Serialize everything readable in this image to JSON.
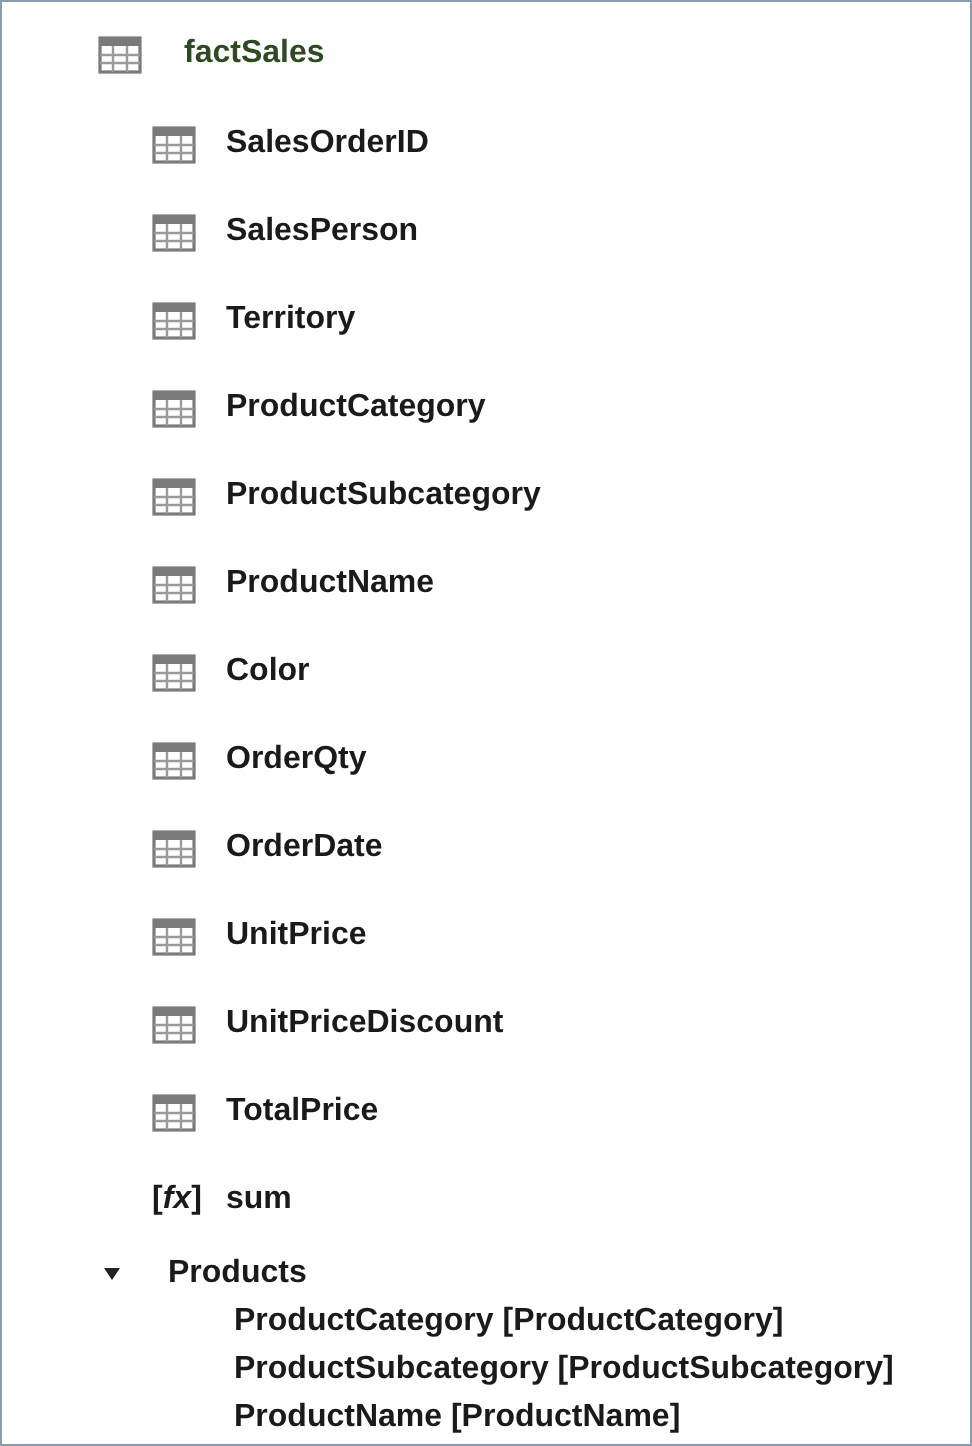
{
  "table": {
    "name": "factSales"
  },
  "fields": [
    {
      "kind": "column",
      "name": "SalesOrderID"
    },
    {
      "kind": "column",
      "name": "SalesPerson"
    },
    {
      "kind": "column",
      "name": "Territory"
    },
    {
      "kind": "column",
      "name": "ProductCategory"
    },
    {
      "kind": "column",
      "name": "ProductSubcategory"
    },
    {
      "kind": "column",
      "name": "ProductName"
    },
    {
      "kind": "column",
      "name": "Color"
    },
    {
      "kind": "column",
      "name": "OrderQty"
    },
    {
      "kind": "column",
      "name": "OrderDate"
    },
    {
      "kind": "column",
      "name": "UnitPrice"
    },
    {
      "kind": "column",
      "name": "UnitPriceDiscount"
    },
    {
      "kind": "column",
      "name": "TotalPrice"
    },
    {
      "kind": "measure",
      "glyph": "[*fx*]",
      "name": "sum"
    }
  ],
  "hierarchy": {
    "name": "Products",
    "expanded": true,
    "children": [
      {
        "name": "ProductCategory [ProductCategory]"
      },
      {
        "name": "ProductSubcategory [ProductSubcategory]"
      },
      {
        "name": "ProductName [ProductName]"
      }
    ]
  }
}
